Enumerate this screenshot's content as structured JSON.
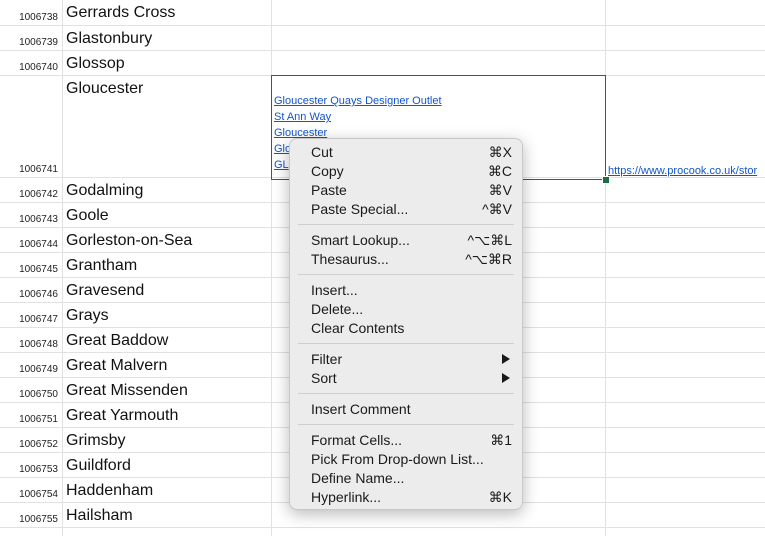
{
  "rows": [
    {
      "num": "1006738",
      "name": "Gerrards Cross"
    },
    {
      "num": "1006739",
      "name": "Glastonbury"
    },
    {
      "num": "1006740",
      "name": "Glossop"
    },
    {
      "num": "1006741",
      "name": "Gloucester"
    },
    {
      "num": "1006742",
      "name": "Godalming"
    },
    {
      "num": "1006743",
      "name": "Goole"
    },
    {
      "num": "1006744",
      "name": "Gorleston-on-Sea"
    },
    {
      "num": "1006745",
      "name": "Grantham"
    },
    {
      "num": "1006746",
      "name": "Gravesend"
    },
    {
      "num": "1006747",
      "name": "Grays"
    },
    {
      "num": "1006748",
      "name": "Great Baddow"
    },
    {
      "num": "1006749",
      "name": "Great Malvern"
    },
    {
      "num": "1006750",
      "name": "Great Missenden"
    },
    {
      "num": "1006751",
      "name": "Great Yarmouth"
    },
    {
      "num": "1006752",
      "name": "Grimsby"
    },
    {
      "num": "1006753",
      "name": "Guildford"
    },
    {
      "num": "1006754",
      "name": "Haddenham"
    },
    {
      "num": "1006755",
      "name": "Hailsham"
    }
  ],
  "selected_cell": {
    "lines": [
      "Gloucester Quays Designer Outlet",
      "St Ann Way",
      "Gloucester",
      "Glo",
      "GL"
    ]
  },
  "url_text": "https://www.procook.co.uk/stor",
  "menu": {
    "groups": [
      [
        {
          "label": "Cut",
          "shortcut": "⌘X"
        },
        {
          "label": "Copy",
          "shortcut": "⌘C"
        },
        {
          "label": "Paste",
          "shortcut": "⌘V"
        },
        {
          "label": "Paste Special...",
          "shortcut": "^⌘V"
        }
      ],
      [
        {
          "label": "Smart Lookup...",
          "shortcut": "^⌥⌘L"
        },
        {
          "label": "Thesaurus...",
          "shortcut": "^⌥⌘R"
        }
      ],
      [
        {
          "label": "Insert...",
          "shortcut": ""
        },
        {
          "label": "Delete...",
          "shortcut": ""
        },
        {
          "label": "Clear Contents",
          "shortcut": ""
        }
      ],
      [
        {
          "label": "Filter",
          "shortcut": "",
          "submenu": true
        },
        {
          "label": "Sort",
          "shortcut": "",
          "submenu": true
        }
      ],
      [
        {
          "label": "Insert Comment",
          "shortcut": ""
        }
      ],
      [
        {
          "label": "Format Cells...",
          "shortcut": "⌘1"
        },
        {
          "label": "Pick From Drop-down List...",
          "shortcut": ""
        },
        {
          "label": "Define Name...",
          "shortcut": ""
        },
        {
          "label": "Hyperlink...",
          "shortcut": "⌘K"
        }
      ]
    ]
  }
}
